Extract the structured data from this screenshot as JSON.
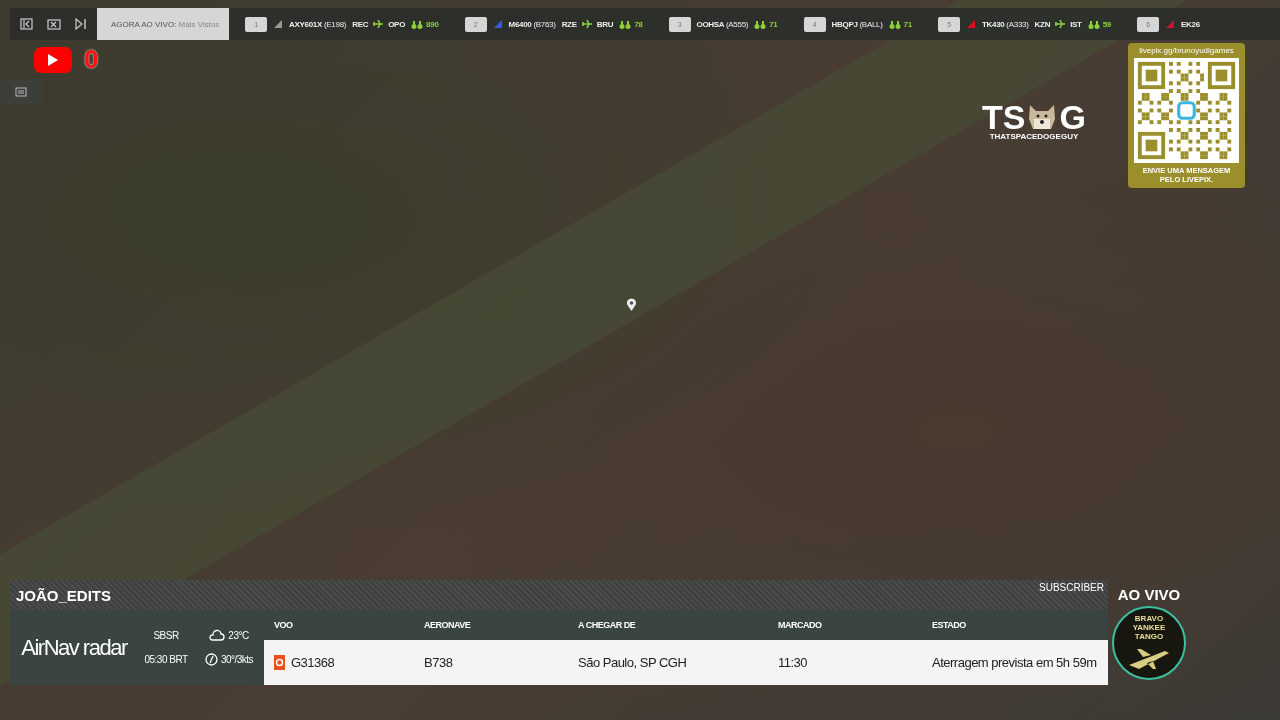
{
  "toolbar": {
    "dropdown": {
      "label": "AGORA AO VIVO:",
      "value": "Mais Vistos"
    }
  },
  "ticker": [
    {
      "rank": "1",
      "callsign": "AXY601X",
      "aircraft": "(E198)",
      "origin": "REC",
      "destination": "OPO",
      "viewers": "890",
      "color": "#9a9a9a"
    },
    {
      "rank": "2",
      "callsign": "M6400",
      "aircraft": "(B763)",
      "origin": "RZE",
      "destination": "BRU",
      "viewers": "78",
      "color": "#3b5bd0"
    },
    {
      "rank": "3",
      "callsign": "OOHSA",
      "aircraft": "(A555)",
      "viewers": "71"
    },
    {
      "rank": "4",
      "callsign": "HBQPJ",
      "aircraft": "(BALL)",
      "viewers": "71"
    },
    {
      "rank": "5",
      "callsign": "TK430",
      "aircraft": "(A333)",
      "origin": "KZN",
      "destination": "IST",
      "viewers": "59",
      "color": "#e30a17"
    },
    {
      "rank": "6",
      "callsign": "EK26",
      "color": "#d0103a"
    }
  ],
  "youtube": {
    "count": "0"
  },
  "channel_logo": {
    "left": "TS",
    "right": "G",
    "caption": "THATSPACEDOGEGUY"
  },
  "donation": {
    "url": "livepix.gg/brunoyudigames",
    "message": "ENVIE UMA MENSAGEM PELO LIVEPIX."
  },
  "streamer_name": "JOÃO_EDITS",
  "badge": "SUBSCRIBER",
  "flight_panel": {
    "brand": "AirNav radar",
    "airport": "SBSR",
    "time": "05:30 BRT",
    "temperature": "23°C",
    "wind": "30°/3kts",
    "columns": [
      "VOO",
      "AERONAVE",
      "A CHEGAR DE",
      "MARCADO",
      "ESTADO"
    ],
    "row": [
      "G31368",
      "B738",
      "São Paulo, SP CGH",
      "11:30",
      "Aterragem prevista em 5h 59m"
    ]
  },
  "live": {
    "label": "AO VIVO",
    "emblem": "BRAVO YANKEE TANGO"
  }
}
